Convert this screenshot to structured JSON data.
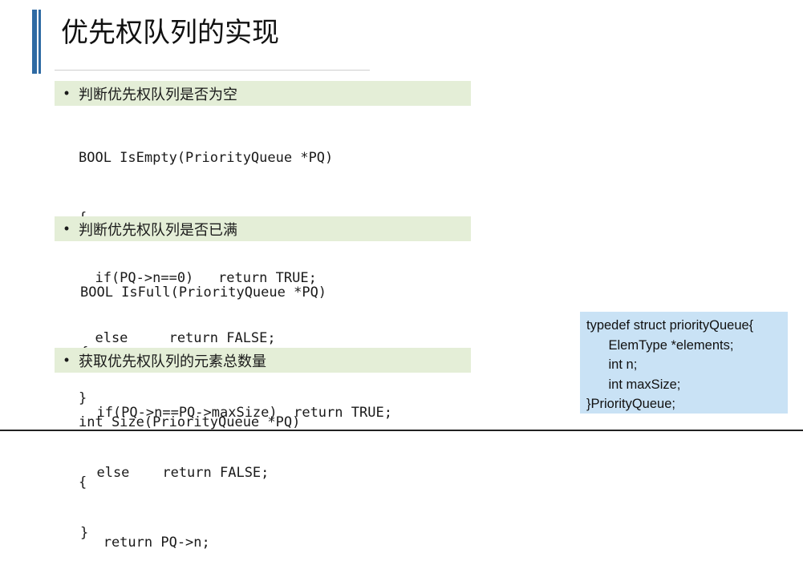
{
  "slide": {
    "title": "优先权队列的实现",
    "sections": [
      {
        "bullet": "判断优先权队列是否为空",
        "code": [
          "BOOL IsEmpty(PriorityQueue *PQ)",
          "{",
          "  if(PQ->n==0)   return TRUE;",
          "  else     return FALSE;",
          "}"
        ]
      },
      {
        "bullet": "判断优先权队列是否已满",
        "code": [
          "BOOL IsFull(PriorityQueue *PQ)",
          "{",
          "  if(PQ->n==PQ->maxSize)  return TRUE;",
          "  else    return FALSE;",
          "}"
        ]
      },
      {
        "bullet": "获取优先权队列的元素总数量",
        "code": [
          "int Size(PriorityQueue *PQ)",
          "{",
          "   return PQ->n;"
        ]
      }
    ],
    "struct_box": [
      "typedef struct priorityQueue{",
      "      ElemType *elements;",
      "      int n;",
      "      int maxSize;",
      "}PriorityQueue;"
    ],
    "colors": {
      "accent_bar": "#2e6aa3",
      "bullet_bg": "#e4eed7",
      "struct_bg": "#c9e2f5"
    }
  }
}
